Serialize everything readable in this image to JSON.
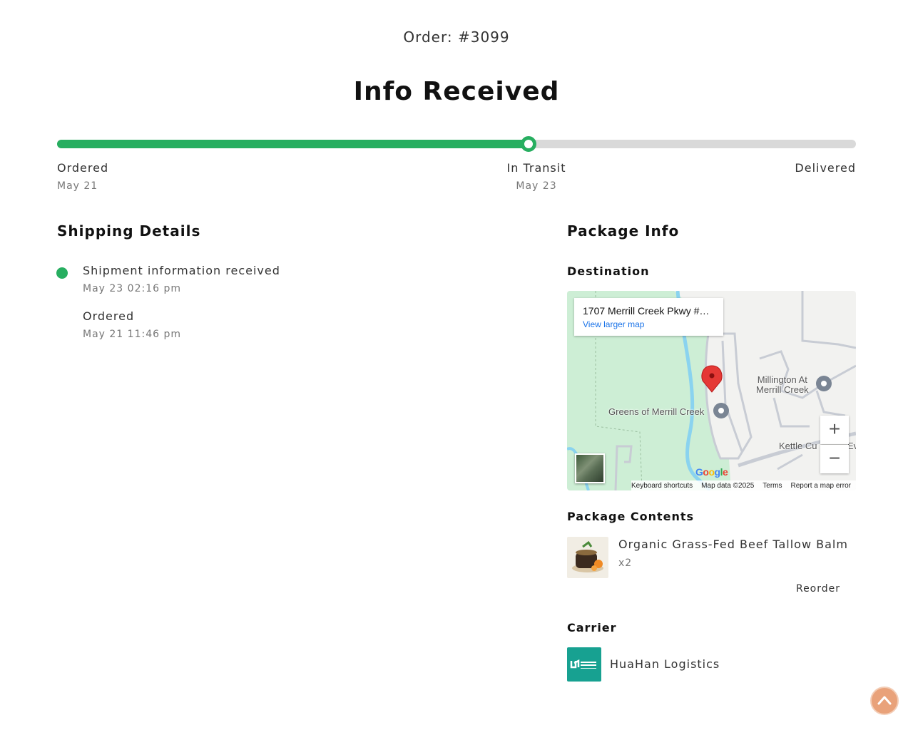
{
  "order": {
    "label": "Order: #3099"
  },
  "status": {
    "title": "Info Received",
    "progress_fraction": 0.59
  },
  "progress_steps": [
    {
      "label": "Ordered",
      "date": "May 21"
    },
    {
      "label": "In Transit",
      "date": "May 23"
    },
    {
      "label": "Delivered",
      "date": ""
    }
  ],
  "colors": {
    "accent": "#27ae60",
    "track": "#d9d9d9",
    "carrier_brand": "#17a191",
    "scroll_button": "#e9a27a"
  },
  "shipping": {
    "title": "Shipping Details",
    "events": [
      {
        "text": "Shipment information received",
        "time": "May 23 02:16 pm"
      },
      {
        "text": "Ordered",
        "time": "May 21 11:46 pm"
      }
    ]
  },
  "package": {
    "title": "Package Info",
    "destination_title": "Destination",
    "map": {
      "address": "1707 Merrill Creek Pkwy #…",
      "view_larger": "View larger map",
      "labels": {
        "millington": "Millington At\nMerrill Creek",
        "greens": "Greens of Merrill Creek",
        "kettle": "Kettle Cu",
        "ev": "Ev"
      },
      "zoom_in": "+",
      "zoom_out": "−",
      "footer": {
        "shortcuts": "Keyboard shortcuts",
        "data": "Map data ©2025",
        "terms": "Terms",
        "report": "Report a map error"
      }
    },
    "contents_title": "Package Contents",
    "item": {
      "name": "Organic Grass-Fed Beef Tallow Balm",
      "qty": "x2",
      "reorder": "Reorder"
    },
    "carrier_title": "Carrier",
    "carrier_name": "HuaHan Logistics"
  },
  "icons": {
    "map_pin": "red-map-pin-icon",
    "place_marker": "gray-place-marker-icon",
    "scroll_top": "chevron-up-icon"
  }
}
